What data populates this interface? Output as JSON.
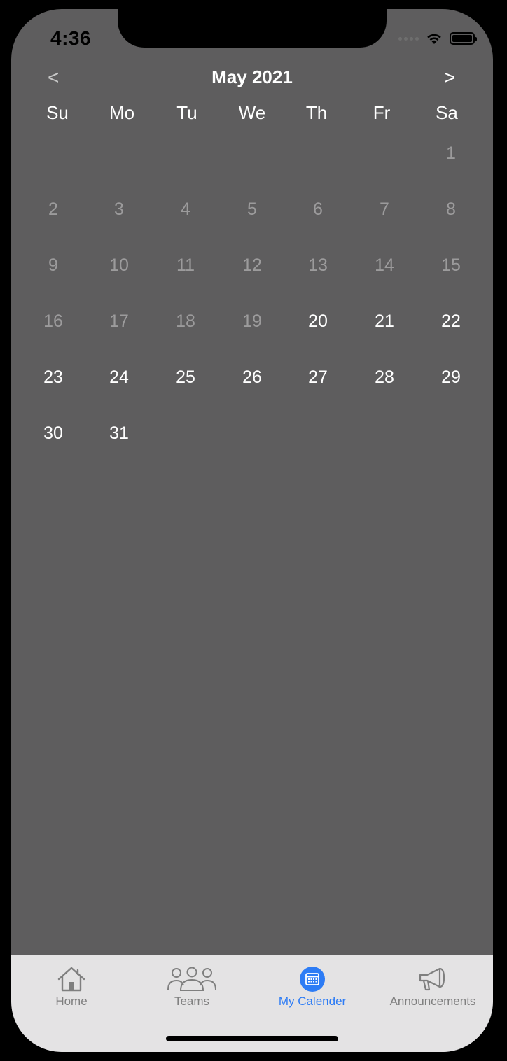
{
  "status_bar": {
    "time": "4:36"
  },
  "calendar": {
    "prev_label": "<",
    "next_label": ">",
    "month_title": "May 2021",
    "weekdays": [
      "Su",
      "Mo",
      "Tu",
      "We",
      "Th",
      "Fr",
      "Sa"
    ],
    "weeks": [
      [
        null,
        null,
        null,
        null,
        null,
        null,
        {
          "day": "1",
          "past": true
        }
      ],
      [
        {
          "day": "2",
          "past": true
        },
        {
          "day": "3",
          "past": true
        },
        {
          "day": "4",
          "past": true
        },
        {
          "day": "5",
          "past": true
        },
        {
          "day": "6",
          "past": true
        },
        {
          "day": "7",
          "past": true
        },
        {
          "day": "8",
          "past": true
        }
      ],
      [
        {
          "day": "9",
          "past": true
        },
        {
          "day": "10",
          "past": true
        },
        {
          "day": "11",
          "past": true
        },
        {
          "day": "12",
          "past": true
        },
        {
          "day": "13",
          "past": true
        },
        {
          "day": "14",
          "past": true
        },
        {
          "day": "15",
          "past": true
        }
      ],
      [
        {
          "day": "16",
          "past": true
        },
        {
          "day": "17",
          "past": true
        },
        {
          "day": "18",
          "past": true
        },
        {
          "day": "19",
          "past": true
        },
        {
          "day": "20",
          "past": false
        },
        {
          "day": "21",
          "past": false
        },
        {
          "day": "22",
          "past": false
        }
      ],
      [
        {
          "day": "23",
          "past": false
        },
        {
          "day": "24",
          "past": false
        },
        {
          "day": "25",
          "past": false
        },
        {
          "day": "26",
          "past": false
        },
        {
          "day": "27",
          "past": false
        },
        {
          "day": "28",
          "past": false
        },
        {
          "day": "29",
          "past": false
        }
      ],
      [
        {
          "day": "30",
          "past": false
        },
        {
          "day": "31",
          "past": false
        },
        null,
        null,
        null,
        null,
        null
      ]
    ]
  },
  "tabbar": {
    "home": {
      "label": "Home",
      "icon": "house-icon"
    },
    "teams": {
      "label": "Teams",
      "icon": "people-icon"
    },
    "calendar": {
      "label": "My Calender",
      "icon": "calendar-icon"
    },
    "announcements": {
      "label": "Announcements",
      "icon": "megaphone-icon"
    }
  },
  "colors": {
    "background": "#5e5d5e",
    "tabbar": "#e4e3e4",
    "accent": "#2d7cf5",
    "inactive": "#7f7f7f",
    "past_day": "#9c9b9c"
  }
}
